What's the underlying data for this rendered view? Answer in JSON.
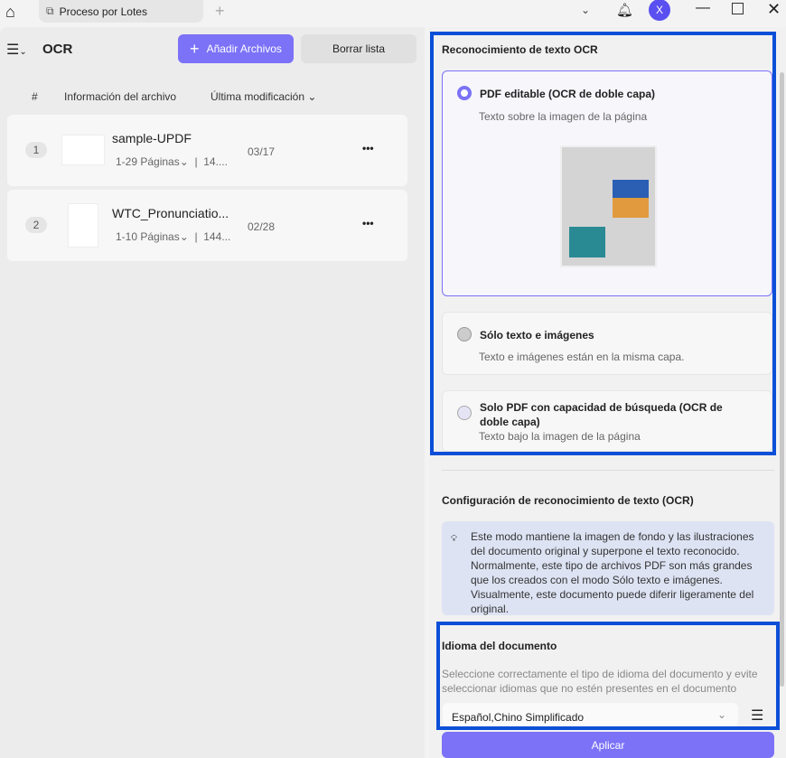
{
  "tab": {
    "title": "Proceso por Lotes"
  },
  "user": {
    "avatar_letter": "X"
  },
  "left": {
    "title": "OCR",
    "add_button": "Añadir Archivos",
    "clear_button": "Borrar lista",
    "columns": {
      "num": "#",
      "info": "Información del archivo",
      "modified": "Última modificación"
    },
    "files": [
      {
        "index": "1",
        "name": "sample-UPDF",
        "pages": "1-29 Páginas",
        "size": "14....",
        "date": "03/17"
      },
      {
        "index": "2",
        "name": "WTC_Pronunciatio...",
        "pages": "1-10 Páginas",
        "size": "144...",
        "date": "02/28"
      }
    ],
    "more": "•••"
  },
  "right": {
    "section_title": "Reconocimiento de texto OCR",
    "options": [
      {
        "label": "PDF editable (OCR de doble capa)",
        "desc": "Texto sobre la imagen de la página",
        "selected": true
      },
      {
        "label": "Sólo texto e imágenes",
        "desc": "Texto e imágenes están en la misma capa.",
        "selected": false
      },
      {
        "label": "Solo PDF con capacidad de búsqueda (OCR de doble capa)",
        "desc": "Texto bajo la imagen de la página",
        "selected": false
      }
    ],
    "config_title": "Configuración de reconocimiento de texto (OCR)",
    "info_text": "Este modo mantiene la imagen de fondo y las ilustraciones del documento original y superpone el texto reconocido. Normalmente, este tipo de archivos PDF son más grandes que los creados con el modo Sólo texto e imágenes. Visualmente, este documento puede diferir ligeramente del original.",
    "lang_title": "Idioma del documento",
    "lang_desc": "Seleccione correctamente el tipo de idioma del documento y evite seleccionar idiomas que no estén presentes en el documento",
    "lang_value": "Español,Chino Simplificado",
    "apply": "Aplicar"
  },
  "colors": {
    "accent": "#7b72f7",
    "highlight": "#0b4fd8"
  }
}
